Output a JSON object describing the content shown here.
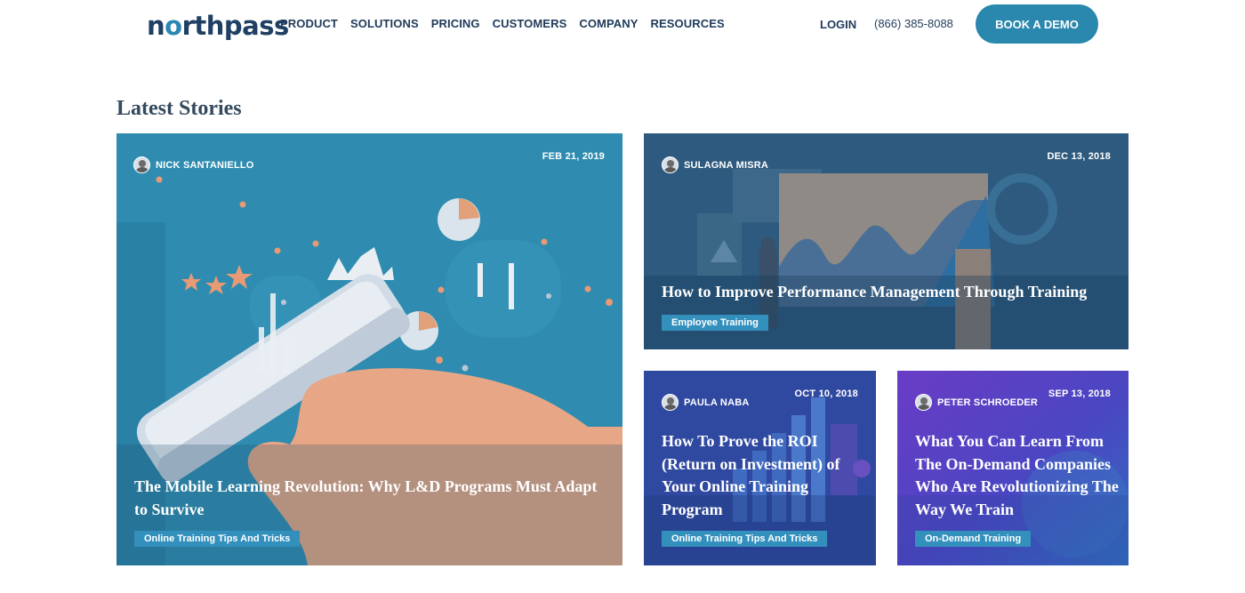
{
  "brand": {
    "logo_text_pre": "n",
    "logo_text_o": "o",
    "logo_text_post": "rthpass"
  },
  "nav": {
    "items": [
      {
        "label": "PRODUCT"
      },
      {
        "label": "SOLUTIONS"
      },
      {
        "label": "PRICING"
      },
      {
        "label": "CUSTOMERS"
      },
      {
        "label": "COMPANY"
      },
      {
        "label": "RESOURCES"
      }
    ],
    "login_label": "LOGIN",
    "phone": "(866) 385-8088",
    "cta_label": "BOOK A DEMO"
  },
  "section_title": "Latest Stories",
  "stories": [
    {
      "author": "NICK SANTANIELLO",
      "date": "FEB 21, 2019",
      "title": "The Mobile Learning Revolution: Why L&D Programs Must Adapt to Survive",
      "tag": "Online Training Tips And Tricks"
    },
    {
      "author": "SULAGNA MISRA",
      "date": "DEC 13, 2018",
      "title": "How to Improve Performance Management Through Training",
      "tag": "Employee Training"
    },
    {
      "author": "PAULA NABA",
      "date": "OCT 10, 2018",
      "title": "How To Prove the ROI (Return on Investment) of Your Online Training Program",
      "tag": "Online Training Tips And Tricks"
    },
    {
      "author": "PETER SCHROEDER",
      "date": "SEP 13, 2018",
      "title": "What You Can Learn From The On-Demand Companies Who Are Revolutionizing The Way We Train",
      "tag": "On-Demand Training"
    }
  ],
  "colors": {
    "brand_navy": "#1f3f63",
    "accent_blue": "#2a87ad",
    "card1_bg": "#2f8cb0",
    "card2_bg": "#2d5a7e",
    "card3_bg": "#2b4fa2",
    "card4_bg": "#5e3ec5",
    "tag_bg": "#3390bd"
  }
}
